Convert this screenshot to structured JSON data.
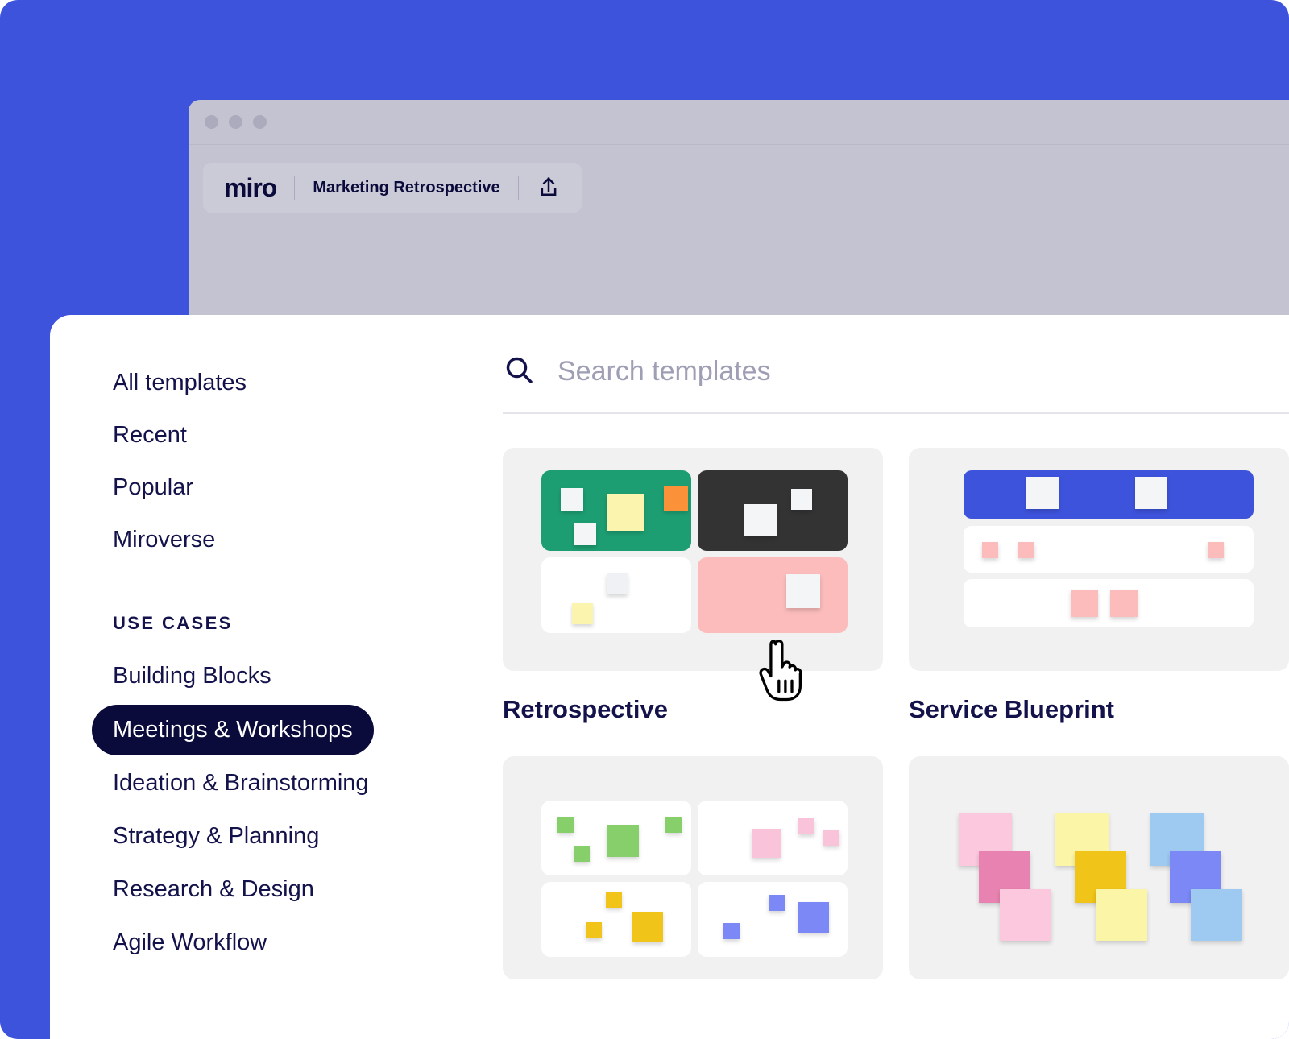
{
  "theme": {
    "background_blue": "#3D53DB",
    "window_gray": "#C3C3D1",
    "toolbar_gray": "#CBCBD8",
    "ink": "#13124A",
    "ink_dark": "#0B0B3B",
    "panel_white": "#FFFFFF",
    "thumb_gray": "#F1F1F1",
    "placeholder_gray": "#9E9EB4"
  },
  "window": {
    "traffic_lights": [
      "red-dot",
      "yellow-dot",
      "green-dot"
    ],
    "logo_text": "miro",
    "board_name": "Marketing Retrospective",
    "share_icon": "upload-share-icon"
  },
  "sidebar": {
    "nav": [
      {
        "label": "All templates"
      },
      {
        "label": "Recent"
      },
      {
        "label": "Popular"
      },
      {
        "label": "Miroverse"
      }
    ],
    "section_label": "USE CASES",
    "use_cases": [
      {
        "label": "Building Blocks",
        "active": false
      },
      {
        "label": "Meetings & Workshops",
        "active": true
      },
      {
        "label": "Ideation & Brainstorming",
        "active": false
      },
      {
        "label": "Strategy & Planning",
        "active": false
      },
      {
        "label": "Research & Design",
        "active": false
      },
      {
        "label": "Agile Workflow",
        "active": false
      }
    ]
  },
  "search": {
    "icon": "search-icon",
    "placeholder": "Search templates",
    "value": ""
  },
  "templates": [
    {
      "title": "Retrospective",
      "thumb_type": "four-quadrant",
      "quadrants": [
        {
          "color": "#1D9E72",
          "notes": [
            {
              "color": "#F4F5F7",
              "size": 28
            },
            {
              "color": "#FAF4AF",
              "size": 46
            },
            {
              "color": "#FB9139",
              "size": 30
            },
            {
              "color": "#F4F5F7",
              "size": 28
            }
          ]
        },
        {
          "color": "#333333",
          "notes": [
            {
              "color": "#F4F5F7",
              "size": 40
            },
            {
              "color": "#F4F5F7",
              "size": 26
            }
          ]
        },
        {
          "color": "#FFFFFF",
          "notes": [
            {
              "color": "#F0F1F4",
              "size": 26
            },
            {
              "color": "#FAF4AF",
              "size": 26
            }
          ]
        },
        {
          "color": "#FCBCBC",
          "notes": [
            {
              "color": "#F4F5F7",
              "size": 42
            }
          ]
        }
      ]
    },
    {
      "title": "Service Blueprint",
      "thumb_type": "three-band",
      "bands": [
        {
          "color": "#3D53DB",
          "notes": [
            {
              "color": "#F4F5F7",
              "size": 40
            },
            {
              "color": "#F4F5F7",
              "size": 40
            }
          ]
        },
        {
          "color": "#FFFFFF",
          "notes": [
            {
              "color": "#FCBCBC",
              "size": 20
            },
            {
              "color": "#FCBCBC",
              "size": 20
            },
            {
              "color": "#FCBCBC",
              "size": 20
            }
          ]
        },
        {
          "color": "#FFFFFF",
          "notes": [
            {
              "color": "#FCBCBC",
              "size": 34
            },
            {
              "color": "#FCBCBC",
              "size": 34
            }
          ]
        }
      ]
    },
    {
      "title": "",
      "thumb_type": "four-quadrant-white",
      "quadrants": [
        {
          "color": "#FFFFFF",
          "notes": [
            {
              "color": "#86CF6A",
              "size": 20
            },
            {
              "color": "#86CF6A",
              "size": 40
            },
            {
              "color": "#86CF6A",
              "size": 20
            },
            {
              "color": "#86CF6A",
              "size": 20
            }
          ]
        },
        {
          "color": "#FFFFFF",
          "notes": [
            {
              "color": "#F9C3DA",
              "size": 36
            },
            {
              "color": "#F9C3DA",
              "size": 20
            },
            {
              "color": "#F9C3DA",
              "size": 20
            }
          ]
        },
        {
          "color": "#FFFFFF",
          "notes": [
            {
              "color": "#F0C419",
              "size": 20
            },
            {
              "color": "#F0C419",
              "size": 38
            },
            {
              "color": "#F0C419",
              "size": 20
            }
          ]
        },
        {
          "color": "#FFFFFF",
          "notes": [
            {
              "color": "#7B88F5",
              "size": 20
            },
            {
              "color": "#7B88F5",
              "size": 38
            },
            {
              "color": "#7B88F5",
              "size": 20
            }
          ]
        }
      ]
    },
    {
      "title": "",
      "thumb_type": "sticky-clusters",
      "clusters": [
        {
          "colors": [
            "#FBC8DE",
            "#E882B0",
            "#FBC8DE"
          ]
        },
        {
          "colors": [
            "#FBF5A8",
            "#F0C419",
            "#FBF5A8"
          ]
        },
        {
          "colors": [
            "#9EC9F0",
            "#7B88F5",
            "#9EC9F0"
          ]
        }
      ]
    }
  ],
  "cursor": {
    "icon": "pointing-hand-cursor"
  }
}
